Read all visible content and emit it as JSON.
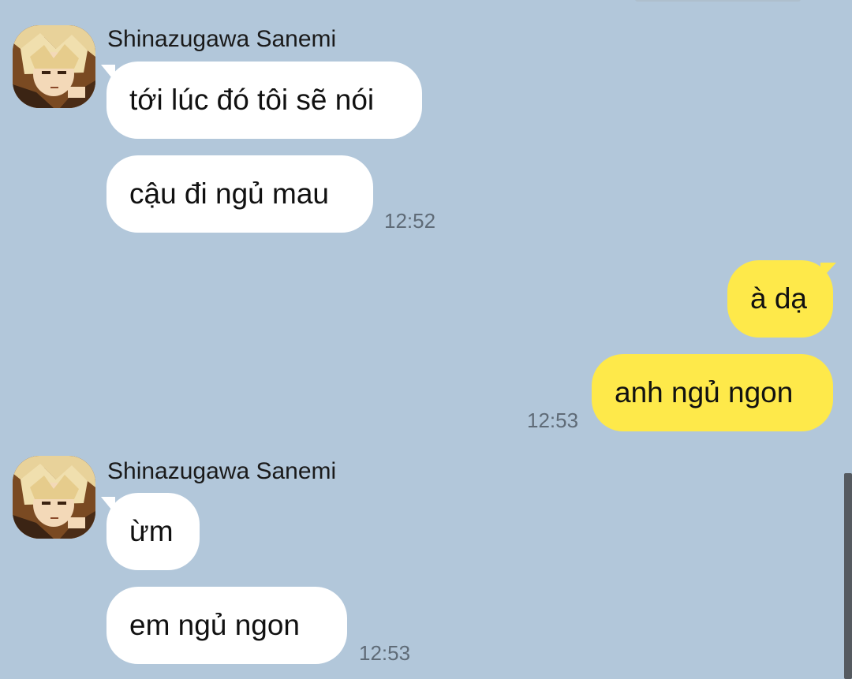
{
  "colors": {
    "background": "#b2c7da",
    "incoming_bubble": "#ffffff",
    "outgoing_bubble": "#fee94a",
    "timestamp": "#5f6b77"
  },
  "messages": {
    "group1": {
      "sender": "Shinazugawa Sanemi",
      "avatar_icon": "anime-avatar-icon",
      "m1": "tới lúc đó tôi sẽ nói",
      "m2": "cậu đi ngủ mau",
      "time": "12:52"
    },
    "group2": {
      "m1": "à dạ",
      "m2": "anh ngủ ngon",
      "time": "12:53"
    },
    "group3": {
      "sender": "Shinazugawa Sanemi",
      "avatar_icon": "anime-avatar-icon",
      "m1": "ừm",
      "m2": "em ngủ ngon",
      "time": "12:53"
    }
  }
}
